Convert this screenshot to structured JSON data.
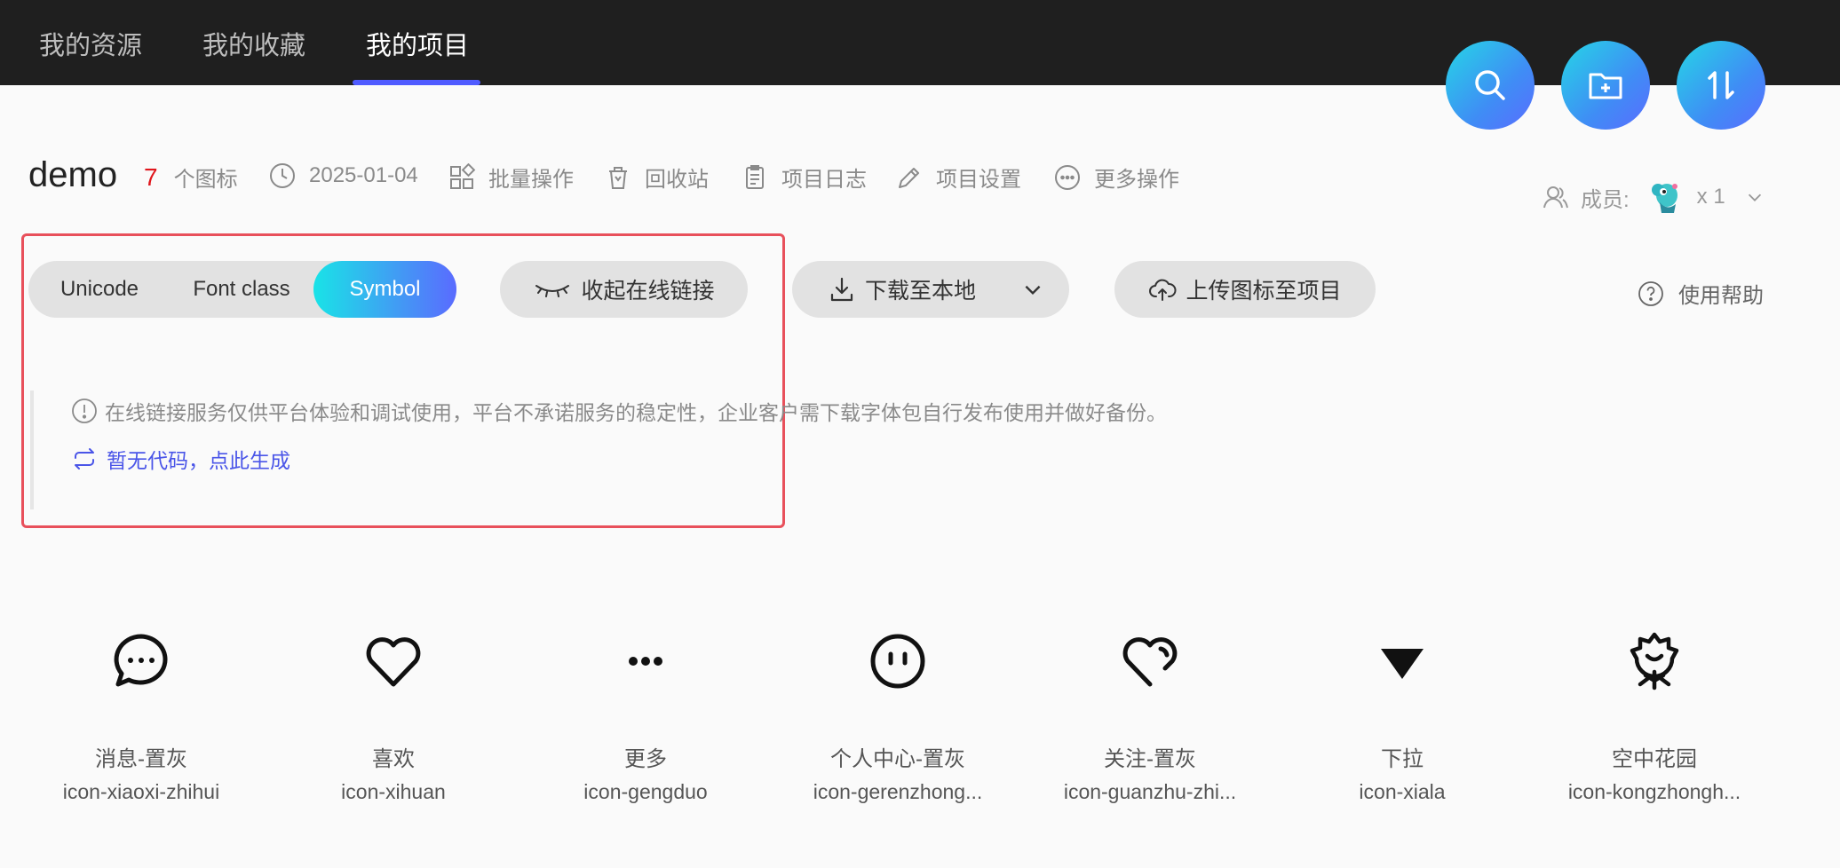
{
  "nav": {
    "tabs": [
      {
        "label": "我的资源"
      },
      {
        "label": "我的收藏"
      },
      {
        "label": "我的项目"
      }
    ],
    "fabs": [
      "search-icon",
      "add-folder-icon",
      "sort-icon"
    ]
  },
  "project": {
    "name": "demo",
    "icon_count": "7",
    "icon_count_suffix": "个图标",
    "date": "2025-01-04",
    "actions": {
      "batch": "批量操作",
      "recycle": "回收站",
      "log": "项目日志",
      "settings": "项目设置",
      "more": "更多操作"
    },
    "members_label": "成员:",
    "members_count": "x 1"
  },
  "toolbar": {
    "modes": [
      "Unicode",
      "Font class",
      "Symbol"
    ],
    "active_mode": "Symbol",
    "collapse_link": "收起在线链接",
    "download": "下载至本地",
    "upload": "上传图标至项目",
    "help": "使用帮助"
  },
  "notice": {
    "text": "在线链接服务仅供平台体验和调试使用，平台不承诺服务的稳定性，企业客户需下载字体包自行发布使用并做好备份。",
    "generate_link": "暂无代码，点此生成"
  },
  "icons": [
    {
      "name": "消息-置灰",
      "code": "icon-xiaoxi-zhihui",
      "glyph": "message-icon"
    },
    {
      "name": "喜欢",
      "code": "icon-xihuan",
      "glyph": "heart-icon"
    },
    {
      "name": "更多",
      "code": "icon-gengduo",
      "glyph": "more-icon"
    },
    {
      "name": "个人中心-置灰",
      "code": "icon-gerenzhong...",
      "glyph": "user-face-icon"
    },
    {
      "name": "关注-置灰",
      "code": "icon-guanzhu-zhi...",
      "glyph": "follow-heart-icon"
    },
    {
      "name": "下拉",
      "code": "icon-xiala",
      "glyph": "dropdown-triangle-icon"
    },
    {
      "name": "空中花园",
      "code": "icon-kongzhongh...",
      "glyph": "flower-icon"
    }
  ],
  "colors": {
    "accent": "#4f5bff",
    "count_red": "#e0161c",
    "link_blue": "#4a55e8",
    "highlight": "#e8505b"
  }
}
